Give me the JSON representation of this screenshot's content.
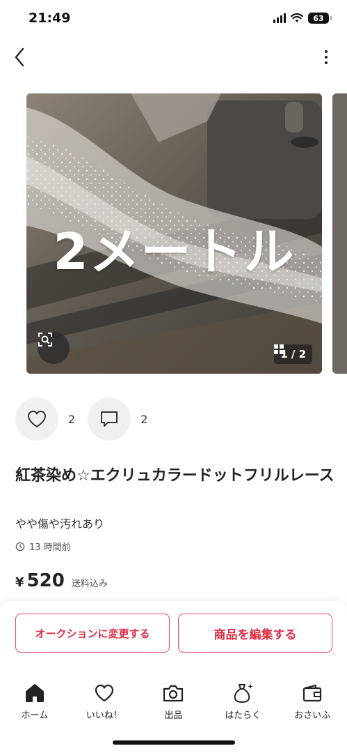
{
  "status_bar": {
    "time": "21:49",
    "battery": "63",
    "icons": [
      "signal-icon",
      "wifi-icon",
      "battery-icon"
    ]
  },
  "nav": {
    "back_icon": "chevron-left-icon",
    "more_icon": "more-vertical-icon"
  },
  "photo": {
    "overlay_text": "2メートル",
    "counter": "1 / 2",
    "zoom_icon": "image-search-icon",
    "counter_icon": "grid-icon"
  },
  "reactions": {
    "likes": "2",
    "comments": "2"
  },
  "item": {
    "title": "紅茶染め☆エクリュカラードットフリルレース",
    "condition": "やや傷や汚れあり",
    "posted": "13 時間前",
    "currency": "¥",
    "price": "520",
    "shipping": "送料込み"
  },
  "actions": {
    "auction_label": "オークションに変更する",
    "edit_label": "商品を編集する"
  },
  "tabs": [
    {
      "label": "ホーム",
      "icon": "home-icon"
    },
    {
      "label": "いいね！",
      "icon": "heart-icon"
    },
    {
      "label": "出品",
      "icon": "camera-icon"
    },
    {
      "label": "はたらく",
      "icon": "money-bag-icon"
    },
    {
      "label": "おさいふ",
      "icon": "wallet-icon"
    }
  ],
  "colors": {
    "accent": "#e02d45",
    "reaction_bg": "#f0f0f0"
  }
}
